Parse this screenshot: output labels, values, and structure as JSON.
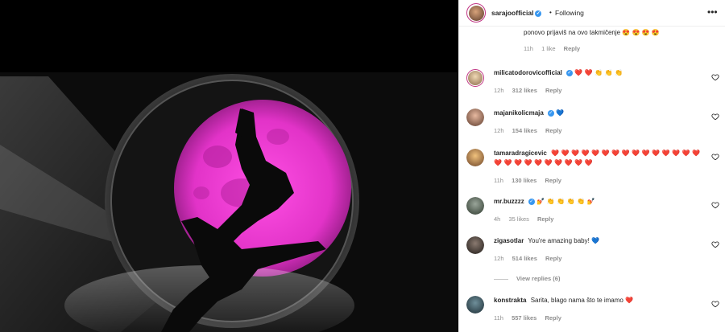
{
  "header": {
    "username": "sarajoofficial",
    "dot": "•",
    "follow_status": "Following",
    "more_icon": "more-options-icon"
  },
  "colors": {
    "moon_pink": "#e233c8",
    "verified_blue": "#3897f0",
    "heart_red": "#ed4956",
    "meta_gray": "#8e8e8e"
  },
  "comments": [
    {
      "username": "",
      "text": "ponovo prijaviš na ovo takmičenje 😍 😍 😍 😍",
      "time": "11h",
      "likes": "1 like",
      "reply": "Reply"
    },
    {
      "username": "milicatodorovicofficial",
      "verified": true,
      "text": "❤️ ❤️ 👏 👏 👏",
      "time": "12h",
      "likes": "312 likes",
      "reply": "Reply"
    },
    {
      "username": "majanikolicmaja",
      "verified": true,
      "text": "💙",
      "time": "12h",
      "likes": "154 likes",
      "reply": "Reply"
    },
    {
      "username": "tamaradragicevic",
      "verified": false,
      "text": "❤️ ❤️ ❤️ ❤️ ❤️ ❤️ ❤️ ❤️ ❤️ ❤️ ❤️ ❤️ ❤️ ❤️ ❤️ ❤️ ❤️ ❤️ ❤️ ❤️ ❤️ ❤️ ❤️ ❤️ ❤️",
      "time": "11h",
      "likes": "130 likes",
      "reply": "Reply"
    },
    {
      "username": "mr.buzzzz",
      "verified": true,
      "text": "💅 👏 👏 👏 👏 💅",
      "time": "4h",
      "likes": "35 likes",
      "reply": "Reply"
    },
    {
      "username": "zigasotlar",
      "verified": false,
      "text": "You're amazing baby! 💙",
      "time": "12h",
      "likes": "514 likes",
      "reply": "Reply",
      "view_replies": "View replies (6)"
    },
    {
      "username": "konstrakta",
      "verified": false,
      "text": "Sarita, blago nama što te imamo ❤️",
      "time": "11h",
      "likes": "557 likes",
      "reply": "Reply"
    }
  ]
}
